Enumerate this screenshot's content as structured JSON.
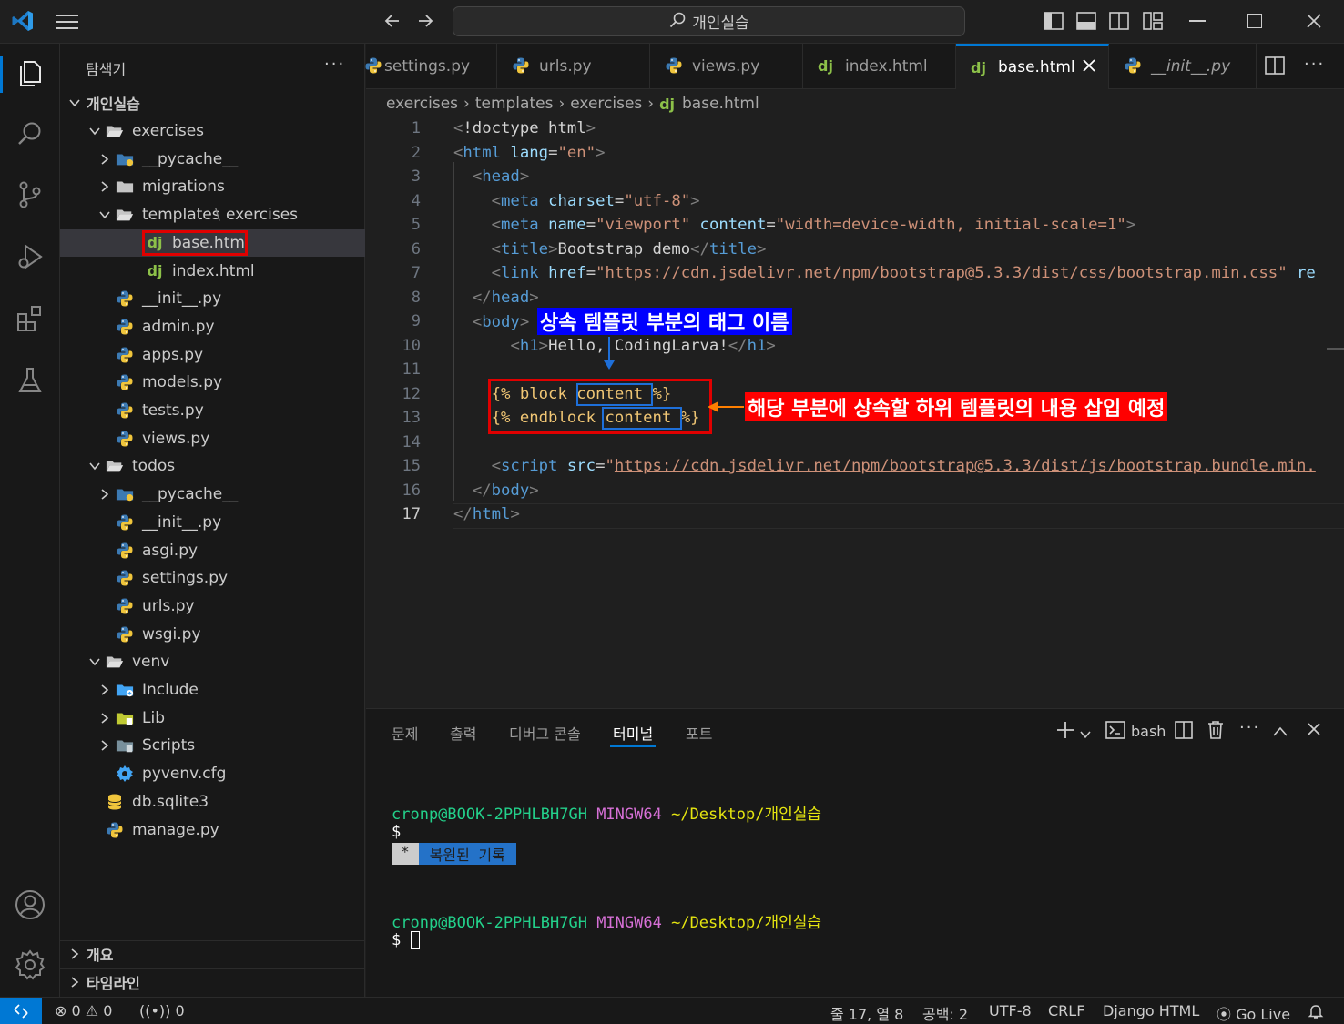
{
  "titlebar": {
    "search": "개인실습"
  },
  "sidebar": {
    "header": "탐색기",
    "root": "개인실습",
    "tree": [
      {
        "label": "exercises",
        "depth": 0,
        "kind": "folder-open",
        "chev": "down"
      },
      {
        "label": "__pycache__",
        "depth": 1,
        "kind": "folder-py",
        "chev": "right"
      },
      {
        "label": "migrations",
        "depth": 1,
        "kind": "folder",
        "chev": "right"
      },
      {
        "label": "templates",
        "label2": "exercises",
        "depth": 1,
        "kind": "folder-open",
        "chev": "down"
      },
      {
        "label": "base.html",
        "depth": 2,
        "kind": "dj",
        "sel": true
      },
      {
        "label": "index.html",
        "depth": 2,
        "kind": "dj"
      },
      {
        "label": "__init__.py",
        "depth": 1,
        "kind": "py"
      },
      {
        "label": "admin.py",
        "depth": 1,
        "kind": "py"
      },
      {
        "label": "apps.py",
        "depth": 1,
        "kind": "py"
      },
      {
        "label": "models.py",
        "depth": 1,
        "kind": "py"
      },
      {
        "label": "tests.py",
        "depth": 1,
        "kind": "py"
      },
      {
        "label": "views.py",
        "depth": 1,
        "kind": "py"
      },
      {
        "label": "todos",
        "depth": 0,
        "kind": "folder-open",
        "chev": "down"
      },
      {
        "label": "__pycache__",
        "depth": 1,
        "kind": "folder-py",
        "chev": "right"
      },
      {
        "label": "__init__.py",
        "depth": 1,
        "kind": "py"
      },
      {
        "label": "asgi.py",
        "depth": 1,
        "kind": "py"
      },
      {
        "label": "settings.py",
        "depth": 1,
        "kind": "py"
      },
      {
        "label": "urls.py",
        "depth": 1,
        "kind": "py"
      },
      {
        "label": "wsgi.py",
        "depth": 1,
        "kind": "py"
      },
      {
        "label": "venv",
        "depth": 0,
        "kind": "folder-open",
        "chev": "down"
      },
      {
        "label": "Include",
        "depth": 1,
        "kind": "folder-inc",
        "chev": "right"
      },
      {
        "label": "Lib",
        "depth": 1,
        "kind": "folder-lib",
        "chev": "right"
      },
      {
        "label": "Scripts",
        "depth": 1,
        "kind": "folder-scr",
        "chev": "right"
      },
      {
        "label": "pyvenv.cfg",
        "depth": 1,
        "kind": "gear"
      },
      {
        "label": "db.sqlite3",
        "depth": 0,
        "kind": "db"
      },
      {
        "label": "manage.py",
        "depth": 0,
        "kind": "py"
      }
    ],
    "outline": "개요",
    "timeline": "타임라인"
  },
  "tabs": [
    {
      "label": "settings.py",
      "icon": "py"
    },
    {
      "label": "urls.py",
      "icon": "py"
    },
    {
      "label": "views.py",
      "icon": "py"
    },
    {
      "label": "index.html",
      "icon": "dj"
    },
    {
      "label": "base.html",
      "icon": "dj",
      "active": true
    },
    {
      "label": "__init__.py",
      "icon": "py",
      "italic": true
    }
  ],
  "breadcrumb": [
    "exercises",
    "templates",
    "exercises",
    "base.html"
  ],
  "code": {
    "line_numbers": [
      "1",
      "2",
      "3",
      "4",
      "5",
      "6",
      "7",
      "8",
      "9",
      "10",
      "11",
      "12",
      "13",
      "14",
      "15",
      "16",
      "17"
    ],
    "l1_doctype": "!doctype html",
    "l2_tag": "html",
    "l2_attr": "lang",
    "l2_val": "\"en\"",
    "l3_tag": "head",
    "l4_tag": "meta",
    "l4_attr": "charset",
    "l4_val": "\"utf-8\"",
    "l5_tag": "meta",
    "l5_attr": "name",
    "l5_val": "\"viewport\"",
    "l5_attr2": "content",
    "l5_val2": "\"width=device-width, initial-scale=1\"",
    "l6_tag": "title",
    "l6_text": "Bootstrap demo",
    "l7_tag": "link",
    "l7_attr": "href",
    "l7_url": "https://cdn.jsdelivr.net/npm/bootstrap@5.3.3/dist/css/bootstrap.min.css",
    "l7_tail": "re",
    "l8_tag": "head",
    "l9_tag": "body",
    "l10_tag": "h1",
    "l10_text": "Hello, CodingLarva!",
    "l12_open": "{%",
    "l12_kw": "block",
    "l12_name": "content",
    "l12_close": "%}",
    "l13_open": "{%",
    "l13_kw": "endblock",
    "l13_name": "content",
    "l13_close": "%}",
    "l15_tag": "script",
    "l15_attr": "src",
    "l15_url": "https://cdn.jsdelivr.net/npm/bootstrap@5.3.3/dist/js/bootstrap.bundle.min.",
    "l16_tag": "body",
    "l17_tag": "html"
  },
  "annotations": {
    "body_note": "상속 템플릿 부분의 태그 이름",
    "block_note": "해당 부분에 상속할 하위 템플릿의 내용 삽입 예정"
  },
  "panel": {
    "tabs": [
      "문제",
      "출력",
      "디버그 콘솔",
      "터미널",
      "포트"
    ],
    "active_tab": "터미널",
    "shell": "bash"
  },
  "terminal": {
    "user": "cronp@BOOK-2PPHLBH7GH",
    "env": "MINGW64",
    "path": "~/Desktop/개인실습",
    "prompt": "$",
    "restored_star": "*",
    "restored": "복원된 기록"
  },
  "status": {
    "errors": "0",
    "warnings": "0",
    "ports": "0",
    "position": "줄 17, 열 8",
    "spaces": "공백: 2",
    "encoding": "UTF-8",
    "eol": "CRLF",
    "language": "Django HTML",
    "golive": "Go Live"
  }
}
